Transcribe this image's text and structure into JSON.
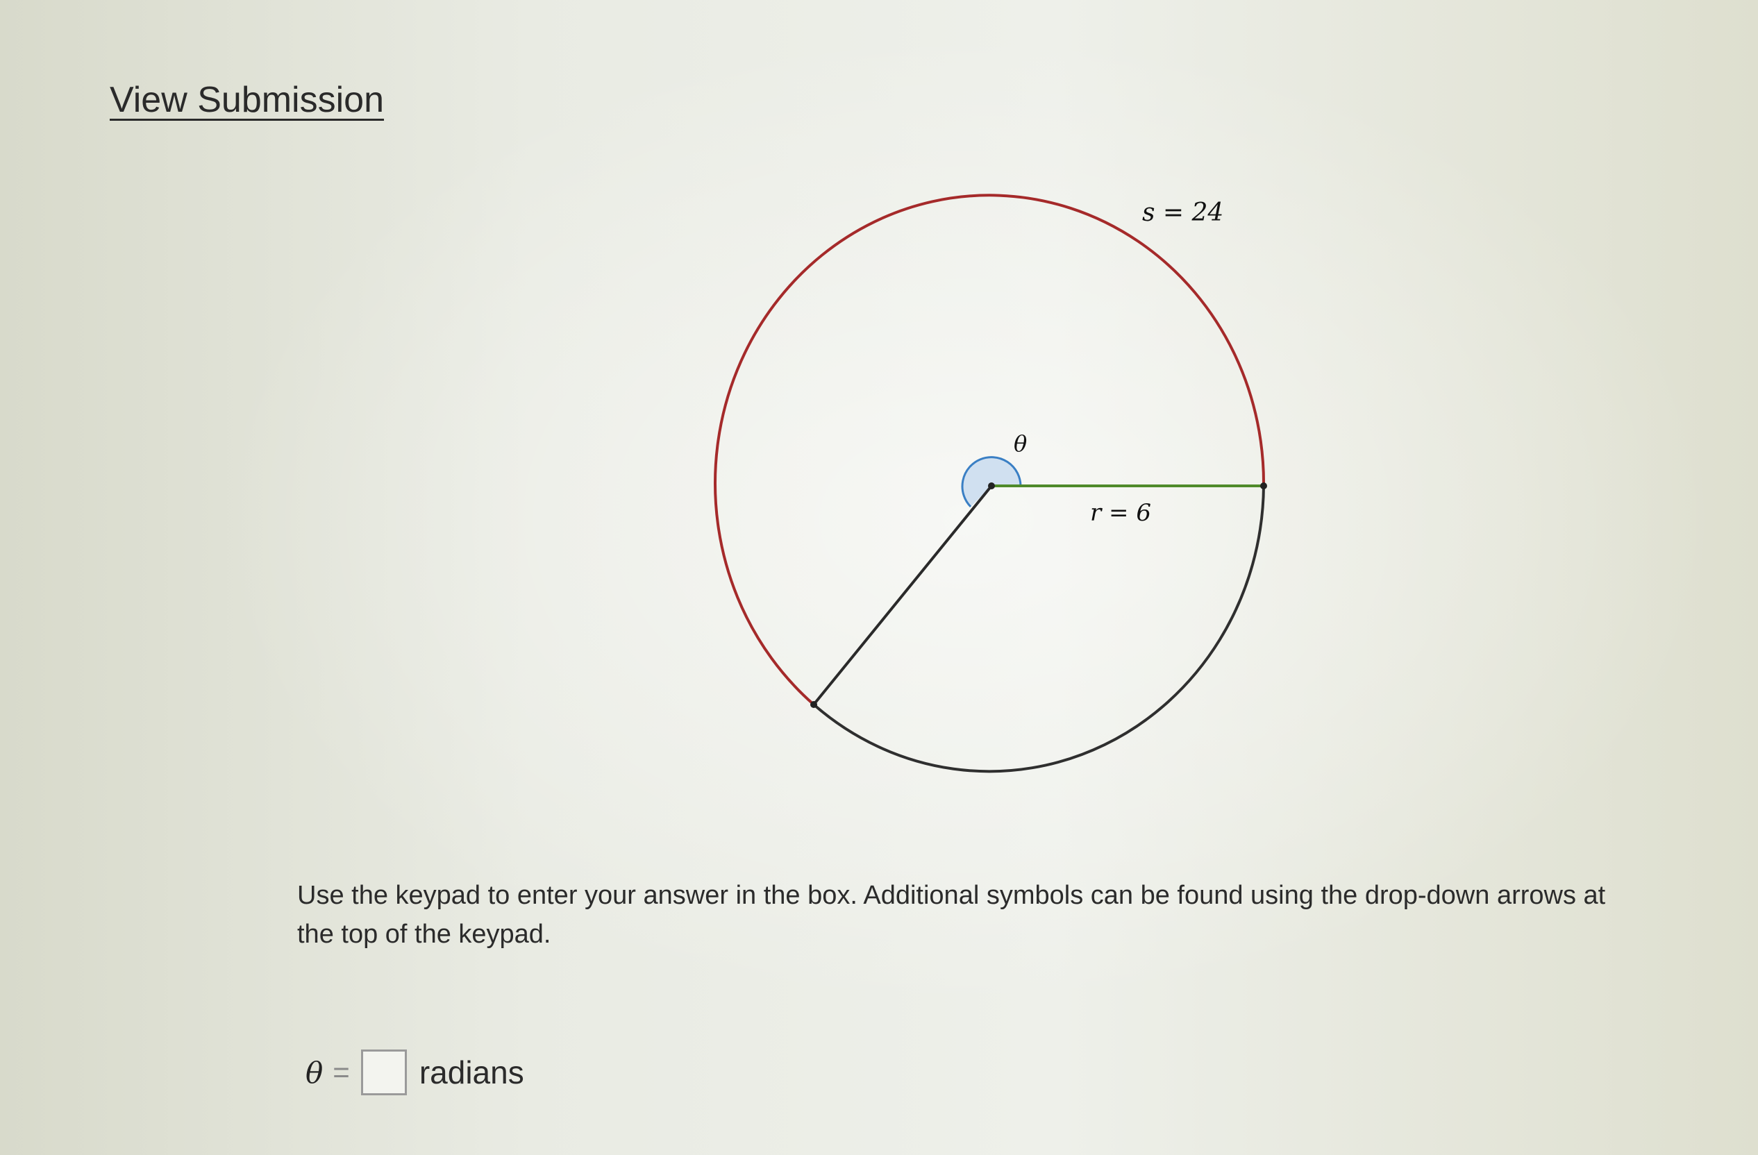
{
  "header": {
    "view_submission": "View Submission"
  },
  "diagram": {
    "arc_label": "s = 24",
    "angle_label": "θ",
    "radius_label": "r = 6",
    "colors": {
      "arc": "#a52a2a",
      "radius_green": "#4f8a2a",
      "radius_dark": "#2a2a2a",
      "angle_fill": "#c9dcef",
      "angle_stroke": "#3a7fc4"
    }
  },
  "question": {
    "instructions": "Use the keypad to enter your answer in the box. Additional symbols can be found using the drop-down arrows at the top of the keypad.",
    "answer_label": "θ",
    "equals": "=",
    "answer_value": "",
    "units": "radians"
  }
}
